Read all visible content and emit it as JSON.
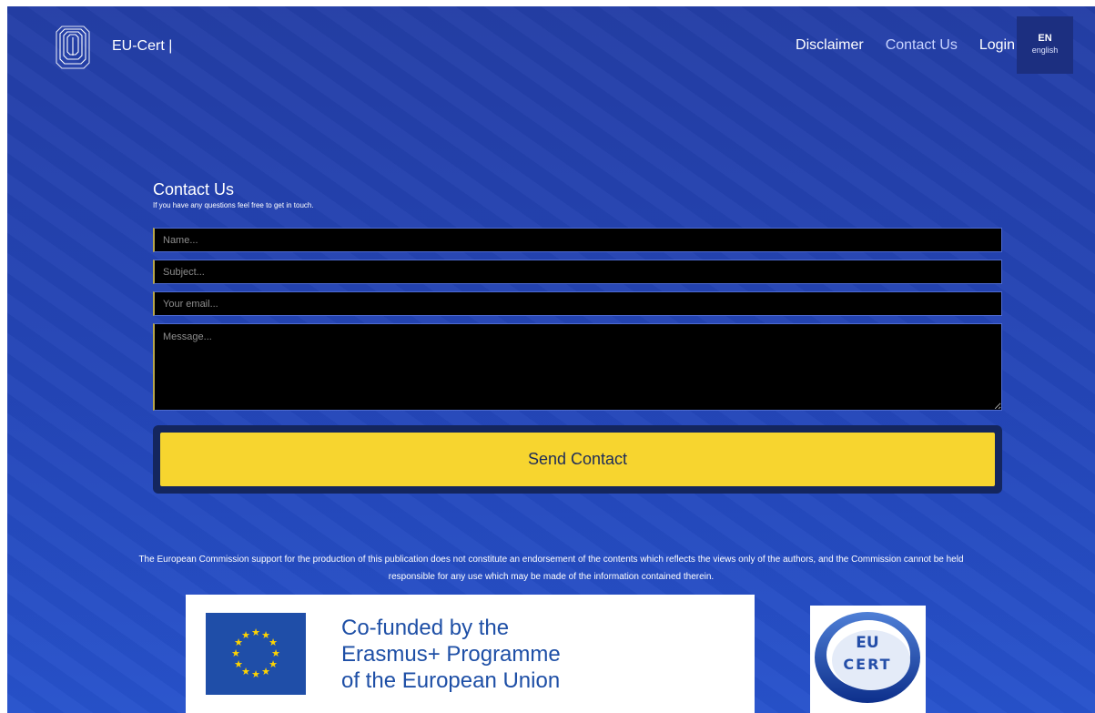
{
  "header": {
    "brand": "EU-Cert |",
    "nav": [
      "Disclaimer",
      "Contact Us",
      "Login"
    ],
    "language": {
      "code": "EN",
      "name": "english"
    }
  },
  "contact": {
    "title": "Contact Us",
    "subtitle": "If you have any questions feel free to get in touch.",
    "name_placeholder": "Name...",
    "subject_placeholder": "Subject...",
    "email_placeholder": "Your email...",
    "message_placeholder": "Message...",
    "send_label": "Send Contact"
  },
  "footer": {
    "disclaimer_line1": "The European Commission support for the production of this publication does not constitute an endorsement of the contents which reflects the views only of the authors, and the Commission cannot be held",
    "disclaimer_line2": "responsible for any use which may be made of the information contained therein.",
    "funded_line1": "Co-funded by the",
    "funded_line2": "Erasmus+ Programme",
    "funded_line3": "of the European Union",
    "cert_logo_text_top": "EU",
    "cert_logo_text_bottom": "CERT"
  },
  "colors": {
    "background": "#2446b8",
    "accent_button": "#f7d52f",
    "eu_blue": "#1f4ea8",
    "eu_star": "#ffd400"
  },
  "icons": {
    "brand_logo": "striped-cube-logo",
    "eu_flag": "eu-flag-icon",
    "cert_logo": "eu-cert-globe-logo"
  }
}
